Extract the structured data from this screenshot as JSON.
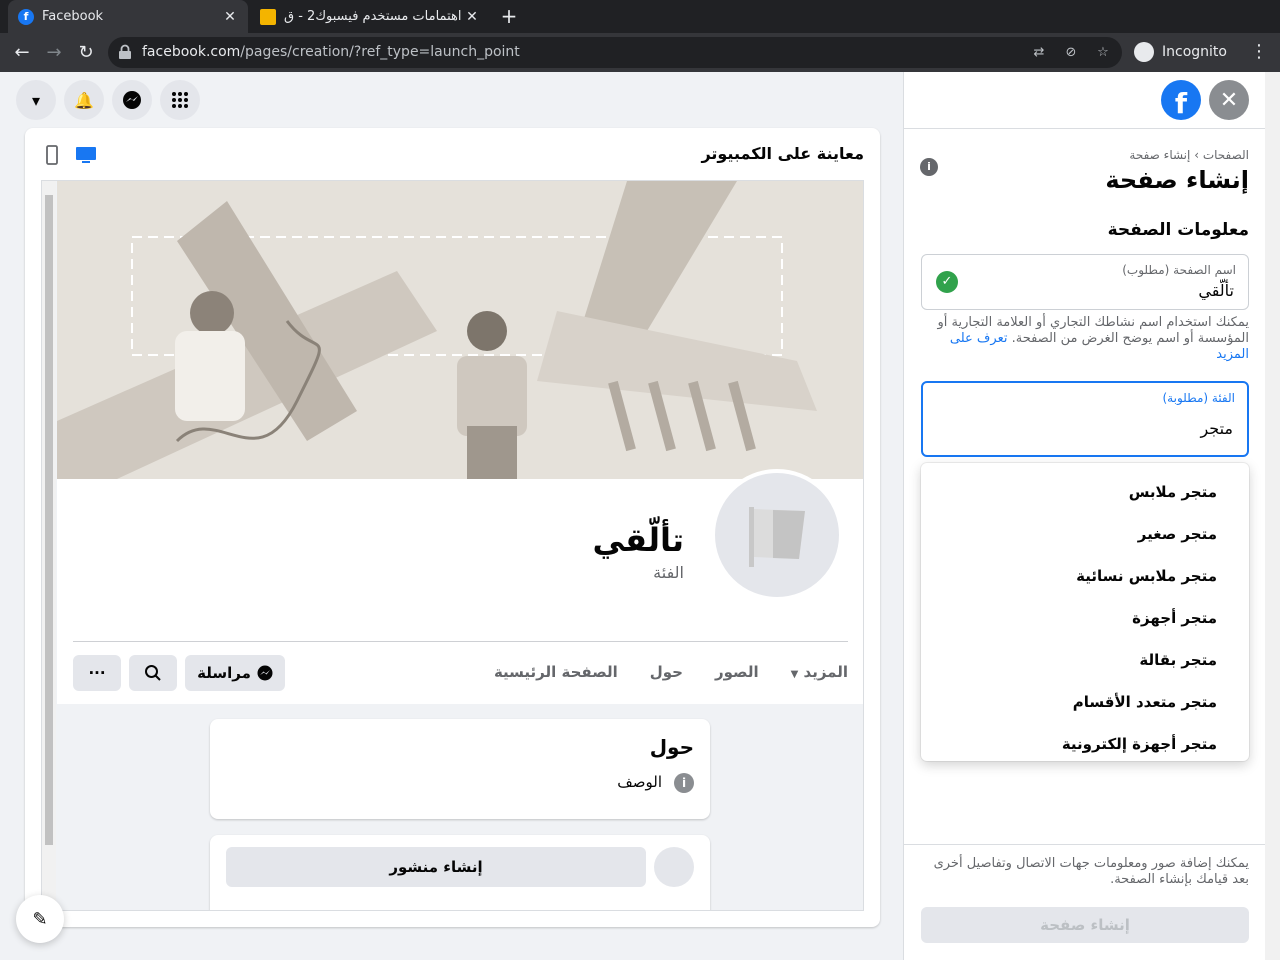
{
  "browser": {
    "tabs": [
      {
        "title": "Facebook",
        "favicon": "facebook-icon",
        "active": true
      },
      {
        "title": "اهتمامات مستخدم فيسبوك2 - ‫ق",
        "favicon": "slides-icon",
        "active": false
      }
    ],
    "url_host": "facebook.com",
    "url_path": "/pages/creation/?ref_type=launch_point",
    "profile_label": "Incognito"
  },
  "preview": {
    "title": "معاينة على الكمبيوتر",
    "page_name": "تألّقي",
    "category_placeholder": "الفئة",
    "tabs": [
      "الصفحة الرئيسية",
      "حول",
      "الصور",
      "المزيد"
    ],
    "message_button": "مراسلة",
    "about_title": "حول",
    "about_description": "الوصف",
    "create_post": "إنشاء منشور"
  },
  "panel": {
    "breadcrumb_root": "الصفحات",
    "breadcrumb_sep": "›",
    "breadcrumb_current": "إنشاء صفحة",
    "title": "إنشاء صفحة",
    "section_title": "معلومات الصفحة",
    "name_field": {
      "label": "اسم الصفحة (مطلوب)",
      "value": "تألّقي"
    },
    "help_text": "يمكنك استخدام اسم نشاطك التجاري أو العلامة التجارية أو المؤسسة أو اسم يوضح الغرض من الصفحة.",
    "help_link": "تعرف على المزيد",
    "category_field": {
      "label": "الفئة (مطلوبة)",
      "value": "متجر"
    },
    "suggestions": [
      "متجر ملابس",
      "متجر صغير",
      "متجر ملابس نسائية",
      "متجر أجهزة",
      "متجر بقالة",
      "متجر متعدد الأقسام",
      "متجر أجهزة إلكترونية"
    ],
    "footer_text": "يمكنك إضافة صور ومعلومات جهات الاتصال وتفاصيل أخرى بعد قيامك بإنشاء الصفحة.",
    "create_button": "إنشاء صفحة"
  },
  "colors": {
    "accent": "#1877f2",
    "success": "#31a24c"
  }
}
